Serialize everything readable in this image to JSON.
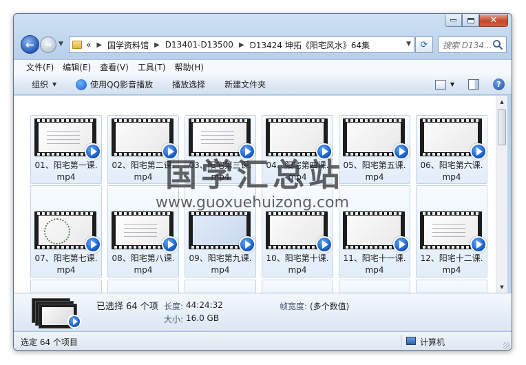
{
  "nav": {
    "back_glyph": "←",
    "forward_glyph": "→",
    "breadcrumb_overflow": "«",
    "breadcrumbs": [
      "国学资料馆",
      "D13401-D13500",
      "D13424 坤拓《阳宅风水》64集"
    ],
    "search_placeholder": "搜索 D134..."
  },
  "menu": [
    "文件(F)",
    "编辑(E)",
    "查看(V)",
    "工具(T)",
    "帮助(H)"
  ],
  "commands": {
    "organize": "组织",
    "qq_play": "使用QQ影音播放",
    "play_selection": "播放选择",
    "new_folder": "新建文件夹"
  },
  "files": [
    {
      "name": "01、阳宅第一课.\nmp4"
    },
    {
      "name": "02、阳宅第二课.\nmp4"
    },
    {
      "name": "03、阳宅第三课.\nmp4"
    },
    {
      "name": "04、阳宅第四课.\nmp4"
    },
    {
      "name": "05、阳宅第五课.\nmp4"
    },
    {
      "name": "06、阳宅第六课.\nmp4"
    },
    {
      "name": "07、阳宅第七课.\nmp4"
    },
    {
      "name": "08、阳宅第八课.\nmp4"
    },
    {
      "name": "09、阳宅第九课.\nmp4"
    },
    {
      "name": "10、阳宅第十课.\nmp4"
    },
    {
      "name": "11、阳宅十一课.\nmp4"
    },
    {
      "name": "12、阳宅十二课.\nmp4"
    }
  ],
  "watermark": {
    "title": "国学汇总站",
    "url": "www.guoxuehuizong.com"
  },
  "details": {
    "selected": "已选择 64 个项",
    "length_label": "长度:",
    "length_value": "44:24:32",
    "size_label": "大小:",
    "size_value": "16.0 GB",
    "framewidth_label": "帧宽度:",
    "framewidth_value": "(多个数值)"
  },
  "status": {
    "selected_text": "选定 64 个项目",
    "location": "计算机"
  }
}
